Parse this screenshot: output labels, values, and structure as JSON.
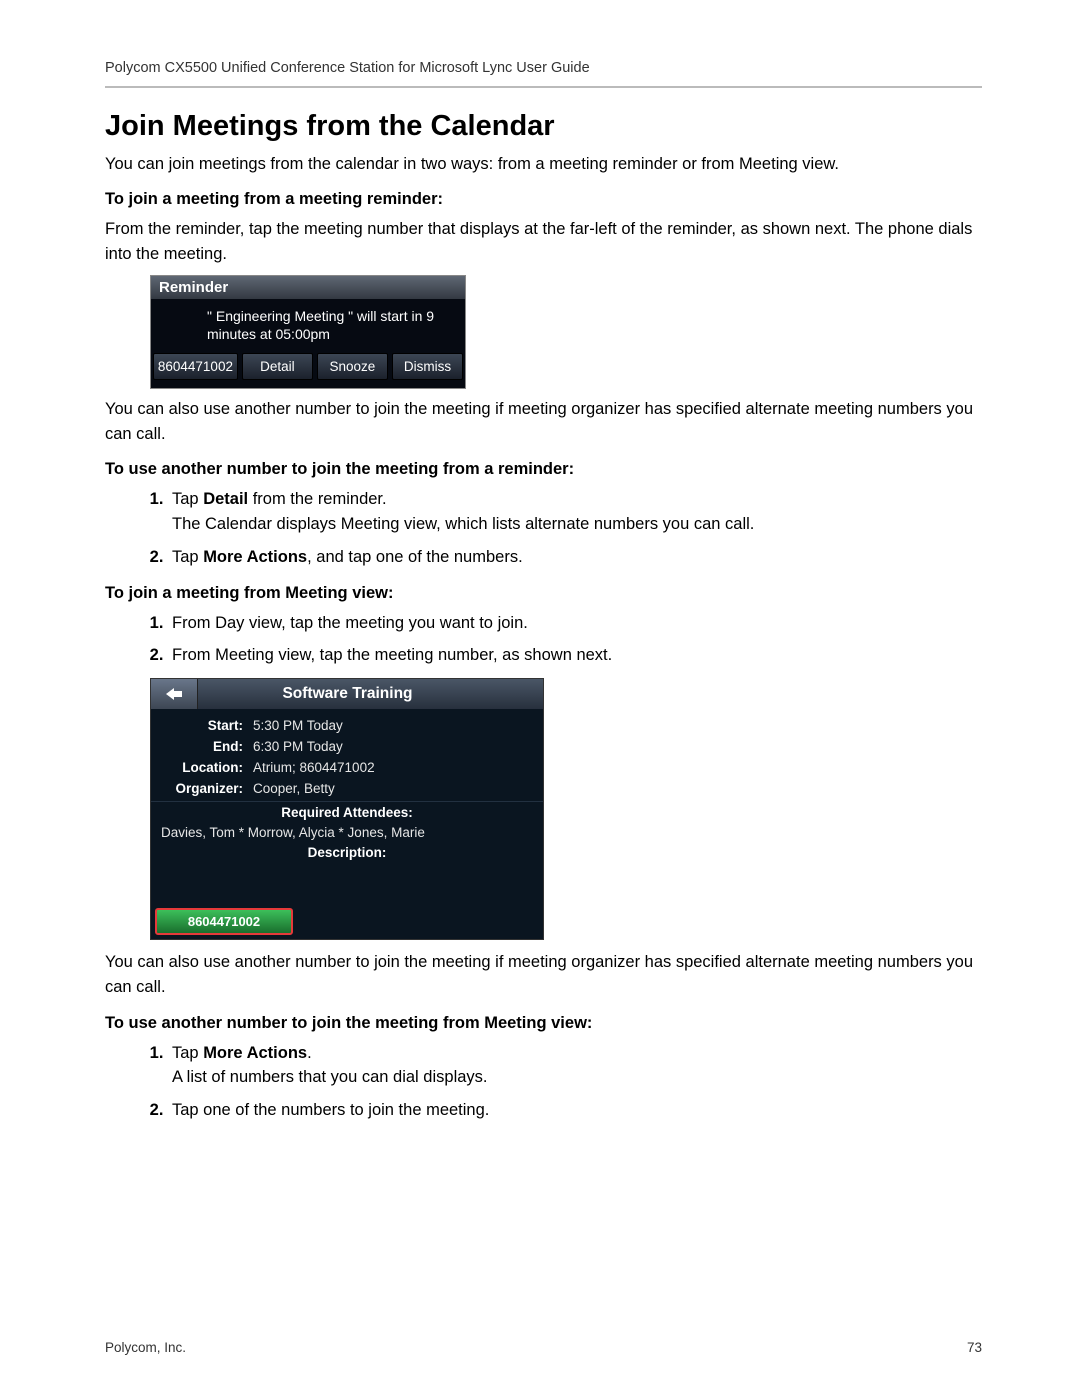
{
  "header": "Polycom CX5500 Unified Conference Station for Microsoft Lync User Guide",
  "title": "Join Meetings from the Calendar",
  "intro": "You can join meetings from the calendar in two ways: from a meeting reminder or from Meeting view.",
  "sub1": "To join a meeting from a meeting reminder:",
  "para1": "From the reminder, tap the meeting number that displays at the far-left of the reminder, as shown next. The phone dials into the meeting.",
  "reminder": {
    "title": "Reminder",
    "message": "\" Engineering Meeting \" will start in 9 minutes at 05:00pm",
    "buttons": [
      "8604471002",
      "Detail",
      "Snooze",
      "Dismiss"
    ]
  },
  "para2": "You can also use another number to join the meeting if meeting organizer has specified alternate meeting numbers you can call.",
  "sub2": "To use another number to join the meeting from a reminder:",
  "list2": {
    "i1a": "Tap ",
    "i1b": "Detail",
    "i1c": " from the reminder.",
    "i1d": "The Calendar displays Meeting view, which lists alternate numbers you can call.",
    "i2a": "Tap ",
    "i2b": "More Actions",
    "i2c": ", and tap one of the numbers."
  },
  "sub3": "To join a meeting from Meeting view:",
  "list3": {
    "i1": "From Day view, tap the meeting you want to join.",
    "i2": "From Meeting view, tap the meeting number, as shown next."
  },
  "meeting": {
    "title": "Software Training",
    "labels": {
      "start": "Start:",
      "end": "End:",
      "location": "Location:",
      "organizer": "Organizer:"
    },
    "values": {
      "start": "5:30 PM Today",
      "end": "6:30 PM Today",
      "location": "Atrium; 8604471002",
      "organizer": "Cooper, Betty"
    },
    "required_label": "Required Attendees:",
    "attendees": "Davies, Tom * Morrow, Alycia * Jones, Marie",
    "description_label": "Description:",
    "dial_number": "8604471002"
  },
  "para3": "You can also use another number to join the meeting if meeting organizer has specified alternate meeting numbers you can call.",
  "sub4": "To use another number to join the meeting from Meeting view:",
  "list4": {
    "i1a": "Tap ",
    "i1b": "More Actions",
    "i1c": ".",
    "i1d": "A list of numbers that you can dial displays.",
    "i2": "Tap one of the numbers to join the meeting."
  },
  "footer": {
    "left": "Polycom, Inc.",
    "right": "73"
  }
}
